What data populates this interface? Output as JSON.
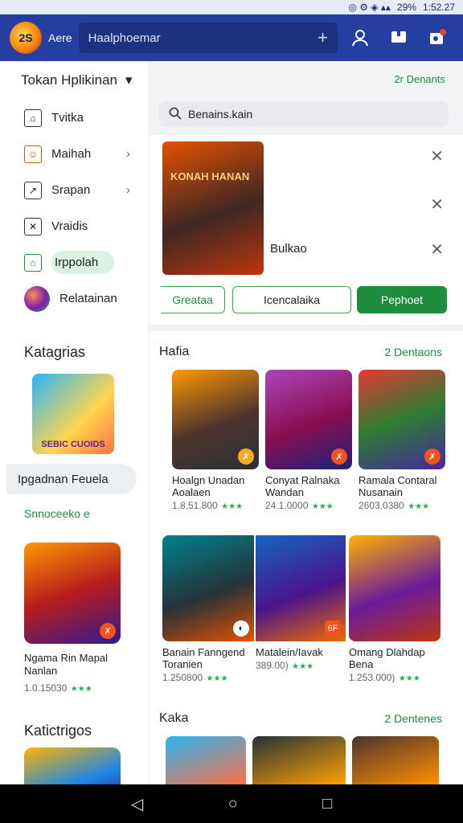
{
  "status": {
    "icons": "◎ ⚙ ◈ ▴▴",
    "battery": "29%",
    "time": "1:52.27"
  },
  "topbar": {
    "logo_text": "2S",
    "app_name": "Aere",
    "search_value": "Haalphoemar",
    "search_plus": "+"
  },
  "sidebar": {
    "title": "Tokan Hplikinan",
    "items": [
      {
        "label": "Tvitka",
        "icon": "building-icon"
      },
      {
        "label": "Maihah",
        "icon": "face-icon",
        "chevron": true
      },
      {
        "label": "Srapan",
        "icon": "chart-icon",
        "chevron": true
      },
      {
        "label": "Vraidis",
        "icon": "box-icon"
      },
      {
        "label": "Irppolah",
        "icon": "home-icon",
        "active": true
      },
      {
        "label": "Relatainan",
        "icon": "avatar"
      }
    ],
    "categories_title": "Katagrias",
    "promo_text": "SEBIC CUOIDS",
    "pill": "Ipgadnan Feuela",
    "sub": "Snnoceeko e",
    "card_title": "Ngama Rin Mapal Nanlan",
    "card_meta": "1.0.15030",
    "card_stars": "★★★",
    "bottom_title": "Katictrigos"
  },
  "main": {
    "header_link": "2r Denants",
    "search_placeholder": "Benains.kain",
    "feature": {
      "image_title": "KONAH HANAN",
      "label": "Bulkao",
      "btn1": "Greataa",
      "btn2": "Icencalaika",
      "btn3": "Pephoet"
    },
    "rows": [
      {
        "title": "Hafia",
        "more": "2 Dentaons",
        "games": [
          {
            "title": "Hoalgn Unadan Aoalaen",
            "meta": "1.8.51.800",
            "stars": "★★★",
            "badge": "✗"
          },
          {
            "title": "Conyat Ralnaka Wandan",
            "meta": "24.1.0000",
            "stars": "★★★",
            "badge": "✗"
          },
          {
            "title": "Ramala Contaral Nusanain",
            "meta": "2603.0380",
            "stars": "★★★",
            "badge": "✗"
          }
        ]
      },
      {
        "title": "",
        "more": "",
        "games": [
          {
            "title": "Banain Fanngend Toranien",
            "meta": "1.250800",
            "stars": "★★★",
            "badge": "◐"
          },
          {
            "title": "Matalein/Iavak",
            "meta": "389.00)",
            "stars": "★★★",
            "badge": "6F"
          },
          {
            "title": "Omang Dlahdap Bena",
            "meta": "1.253.000)",
            "stars": "★★★",
            "badge": ""
          }
        ]
      },
      {
        "title": "Kaka",
        "more": "2 Dentenes"
      }
    ]
  },
  "navbar": {
    "back": "◁",
    "home": "○",
    "recents": "□"
  }
}
